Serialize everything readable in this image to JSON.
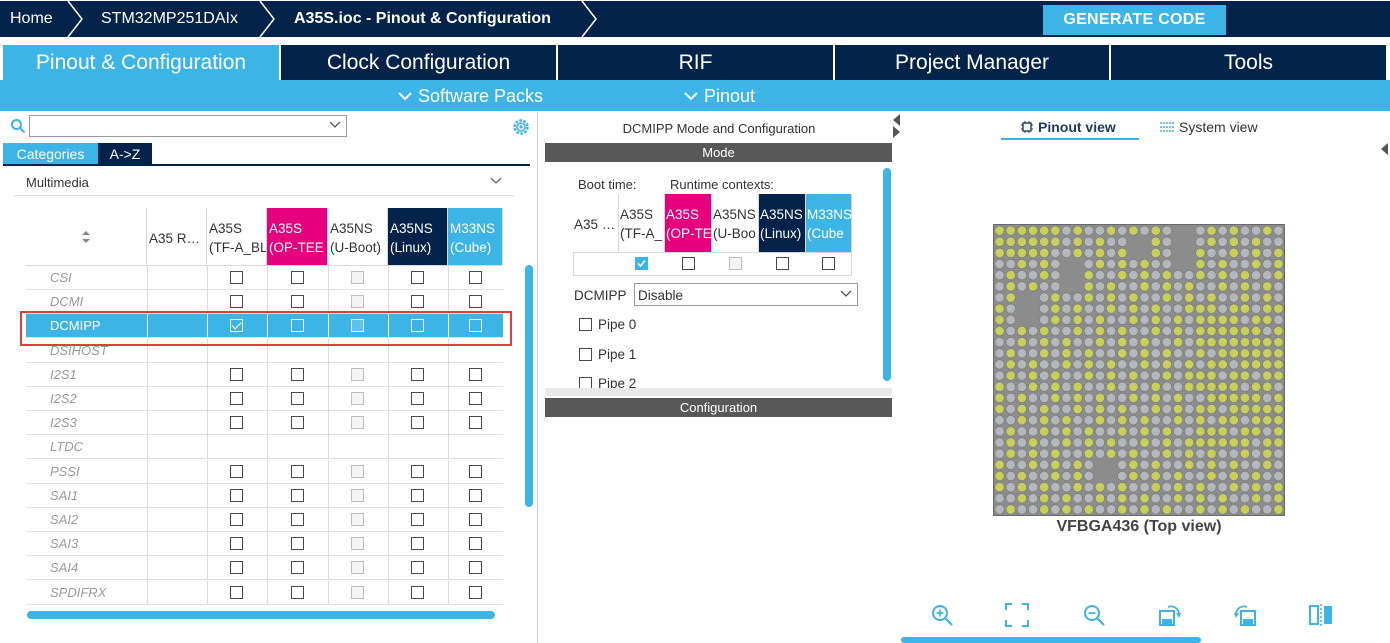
{
  "breadcrumb": {
    "home": "Home",
    "device": "STM32MP251DAIx",
    "file": "A35S.ioc - Pinout & Configuration"
  },
  "generate_button": "GENERATE CODE",
  "tabs": [
    "Pinout & Configuration",
    "Clock Configuration",
    "RIF",
    "Project Manager",
    "Tools"
  ],
  "subbar": {
    "software_packs": "Software Packs",
    "pinout": "Pinout"
  },
  "left": {
    "category_tabs": [
      "Categories",
      "A->Z"
    ],
    "group": "Multimedia",
    "sort_icon": "sort-icon",
    "columns": [
      {
        "l1": "A35 R…",
        "l2": ""
      },
      {
        "l1": "A35S",
        "l2": "(TF-A_BL"
      },
      {
        "l1": "A35S",
        "l2": "(OP-TEE"
      },
      {
        "l1": "A35NS",
        "l2": "(U-Boot)"
      },
      {
        "l1": "A35NS",
        "l2": "(Linux)"
      },
      {
        "l1": "M33NS",
        "l2": "(Cube)"
      }
    ],
    "rows": [
      {
        "name": "CSI",
        "cb": [
          "n",
          "n",
          "d",
          "n",
          "n"
        ]
      },
      {
        "name": "DCMI",
        "cb": [
          "n",
          "n",
          "d",
          "n",
          "n"
        ]
      },
      {
        "name": "DCMIPP",
        "cb": [
          "c",
          "n",
          "d",
          "n",
          "n"
        ],
        "selected": true
      },
      {
        "name": "DSIHOST",
        "cb": []
      },
      {
        "name": "I2S1",
        "cb": [
          "n",
          "n",
          "d",
          "n",
          "n"
        ]
      },
      {
        "name": "I2S2",
        "cb": [
          "n",
          "n",
          "d",
          "n",
          "n"
        ]
      },
      {
        "name": "I2S3",
        "cb": [
          "n",
          "n",
          "d",
          "n",
          "n"
        ]
      },
      {
        "name": "LTDC",
        "cb": []
      },
      {
        "name": "PSSI",
        "cb": [
          "n",
          "n",
          "d",
          "n",
          "n"
        ]
      },
      {
        "name": "SAI1",
        "cb": [
          "n",
          "n",
          "d",
          "n",
          "n"
        ]
      },
      {
        "name": "SAI2",
        "cb": [
          "n",
          "n",
          "d",
          "n",
          "n"
        ]
      },
      {
        "name": "SAI3",
        "cb": [
          "n",
          "n",
          "d",
          "n",
          "n"
        ]
      },
      {
        "name": "SAI4",
        "cb": [
          "n",
          "n",
          "d",
          "n",
          "n"
        ]
      },
      {
        "name": "SPDIFRX",
        "cb": [
          "n",
          "n",
          "d",
          "n",
          "n"
        ]
      }
    ]
  },
  "mid": {
    "title": "DCMIPP Mode and Configuration",
    "mode_header": "Mode",
    "boot_time": "Boot time:",
    "runtime_contexts": "Runtime contexts:",
    "columns": [
      {
        "l1": "A35 …",
        "l2": ""
      },
      {
        "l1": "A35S",
        "l2": "(TF-A_"
      },
      {
        "l1": "A35S",
        "l2": "(OP-TE"
      },
      {
        "l1": "A35NS",
        "l2": "(U-Boo"
      },
      {
        "l1": "A35NS",
        "l2": "(Linux)"
      },
      {
        "l1": "M33NS",
        "l2": "(Cube"
      }
    ],
    "dcmipp_label": "DCMIPP",
    "dcmipp_value": "Disable",
    "pipes": [
      "Pipe 0",
      "Pipe 1",
      "Pipe 2"
    ],
    "config_header": "Configuration"
  },
  "right": {
    "pinout_view": "Pinout view",
    "system_view": "System view",
    "package_label": "VFBGA436 (Top view)"
  },
  "colors": {
    "navy": "#03234b",
    "accent": "#3cb4e6",
    "magenta": "#e6007e",
    "pin_green": "#c8cf5a",
    "pin_gray": "#b4b8bc"
  }
}
